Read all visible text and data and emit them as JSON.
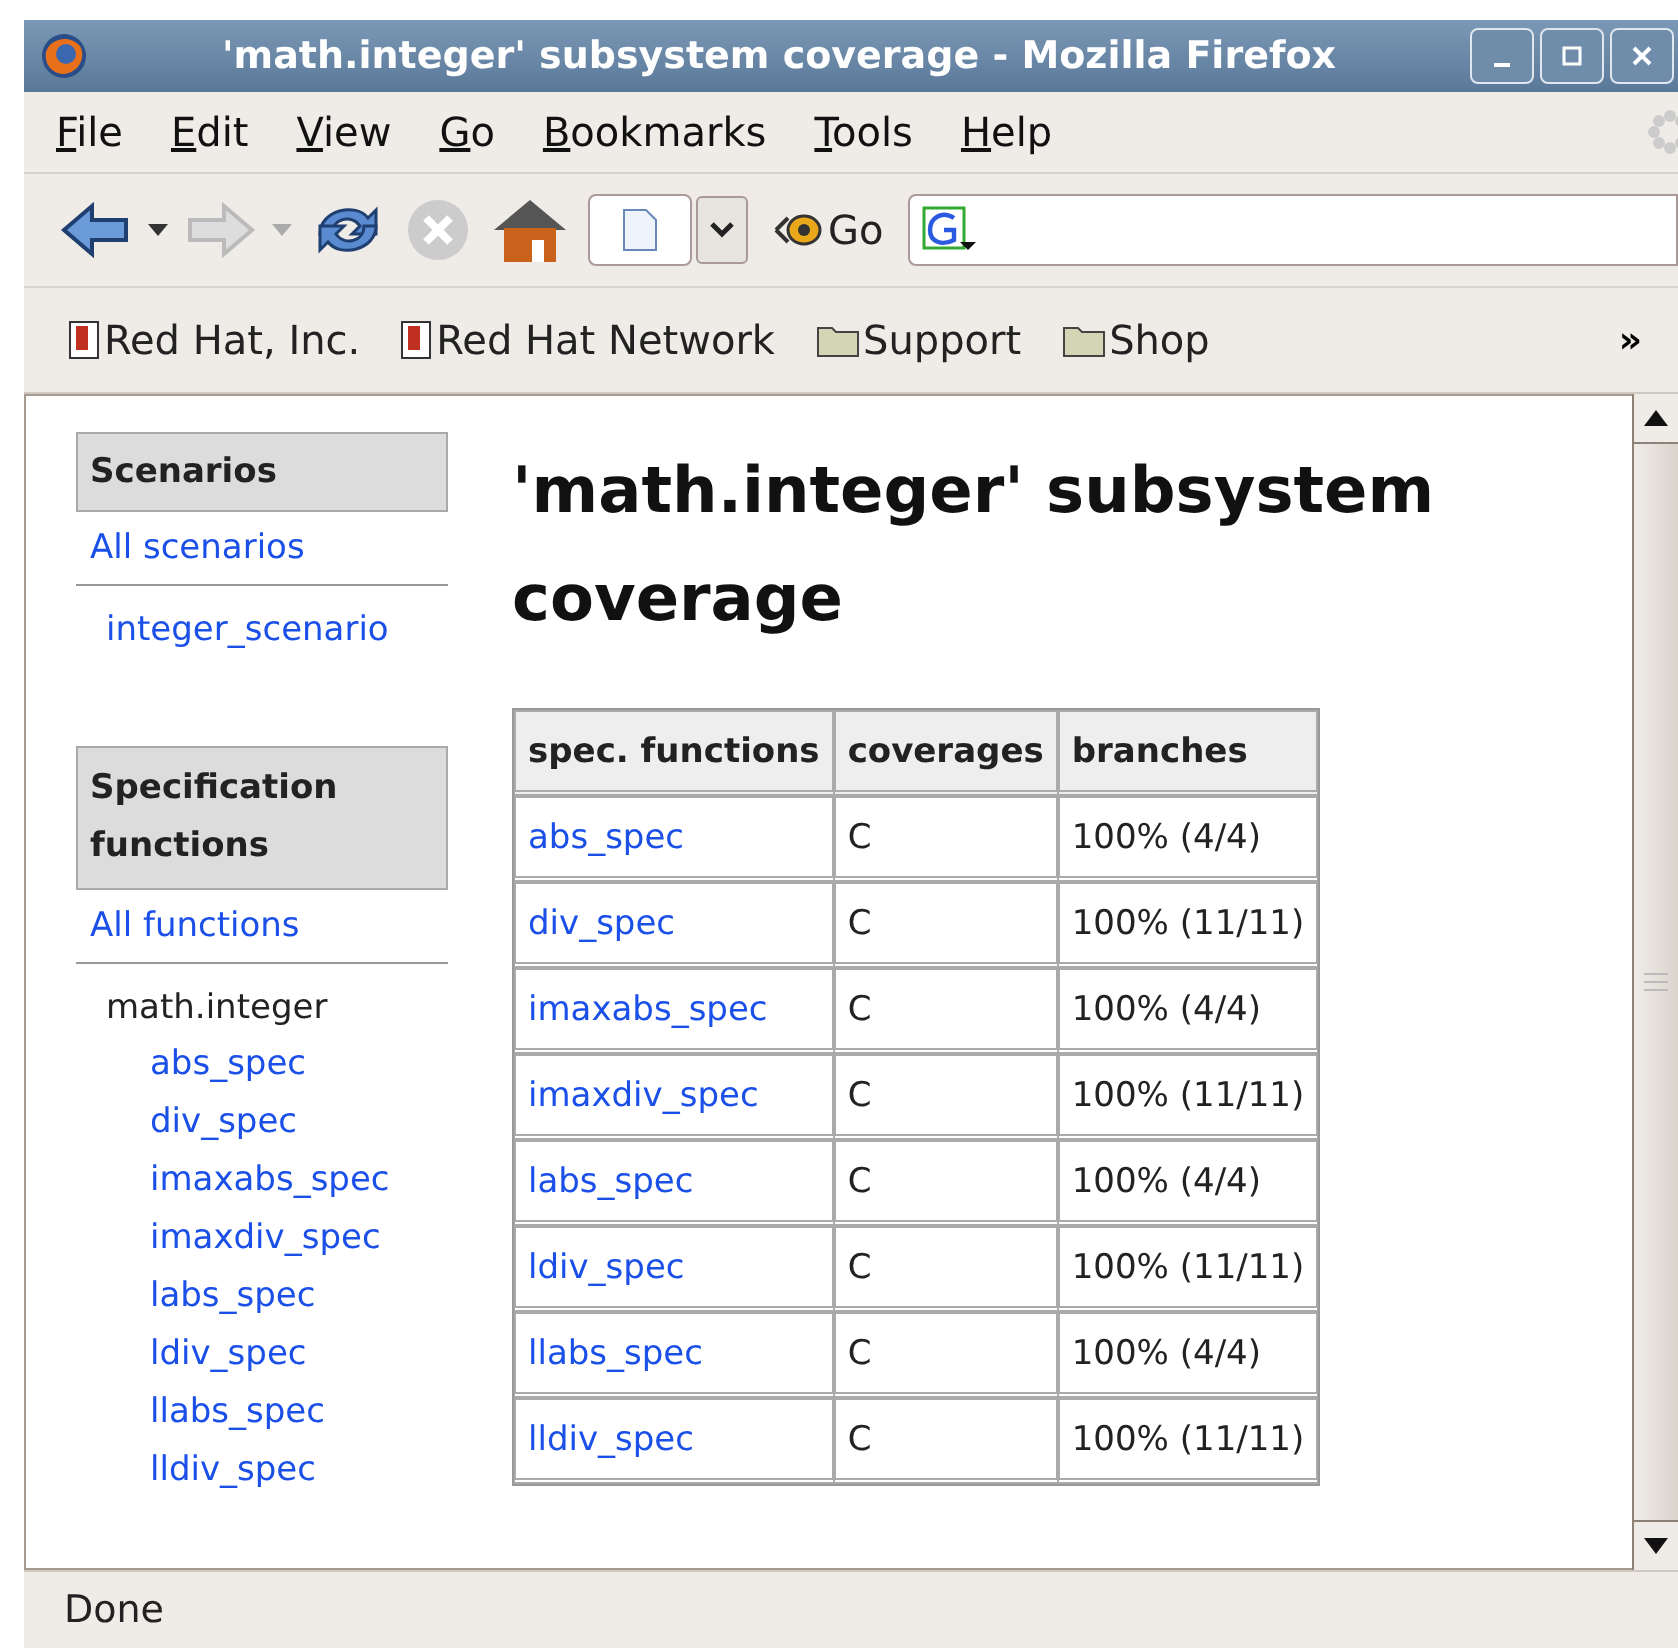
{
  "window": {
    "title": "'math.integer' subsystem coverage - Mozilla Firefox"
  },
  "menu": [
    "File",
    "Edit",
    "View",
    "Go",
    "Bookmarks",
    "Tools",
    "Help"
  ],
  "toolbar": {
    "go_label": "Go"
  },
  "bookmarks": [
    {
      "label": "Red Hat, Inc.",
      "kind": "page"
    },
    {
      "label": "Red Hat Network",
      "kind": "page"
    },
    {
      "label": "Support",
      "kind": "folder"
    },
    {
      "label": "Shop",
      "kind": "folder"
    }
  ],
  "bookmarks_more": "»",
  "sidebar": {
    "sections": [
      {
        "heading": "Scenarios",
        "all_link": "All scenarios",
        "items": [
          {
            "label": "integer_scenario"
          }
        ]
      },
      {
        "heading": "Specification functions",
        "all_link": "All functions",
        "items": [
          {
            "label": "math.integer",
            "children": [
              {
                "label": "abs_spec"
              },
              {
                "label": "div_spec"
              },
              {
                "label": "imaxabs_spec"
              },
              {
                "label": "imaxdiv_spec"
              },
              {
                "label": "labs_spec"
              },
              {
                "label": "ldiv_spec"
              },
              {
                "label": "llabs_spec"
              },
              {
                "label": "lldiv_spec"
              }
            ]
          }
        ]
      }
    ]
  },
  "page": {
    "heading": "'math.integer' subsystem coverage"
  },
  "table": {
    "columns": [
      "spec. functions",
      "coverages",
      "branches"
    ],
    "rows": [
      [
        "abs_spec",
        "C",
        "100% (4/4)"
      ],
      [
        "div_spec",
        "C",
        "100% (11/11)"
      ],
      [
        "imaxabs_spec",
        "C",
        "100% (4/4)"
      ],
      [
        "imaxdiv_spec",
        "C",
        "100% (11/11)"
      ],
      [
        "labs_spec",
        "C",
        "100% (4/4)"
      ],
      [
        "ldiv_spec",
        "C",
        "100% (11/11)"
      ],
      [
        "llabs_spec",
        "C",
        "100% (4/4)"
      ],
      [
        "lldiv_spec",
        "C",
        "100% (11/11)"
      ]
    ]
  },
  "status_bar": "Done"
}
